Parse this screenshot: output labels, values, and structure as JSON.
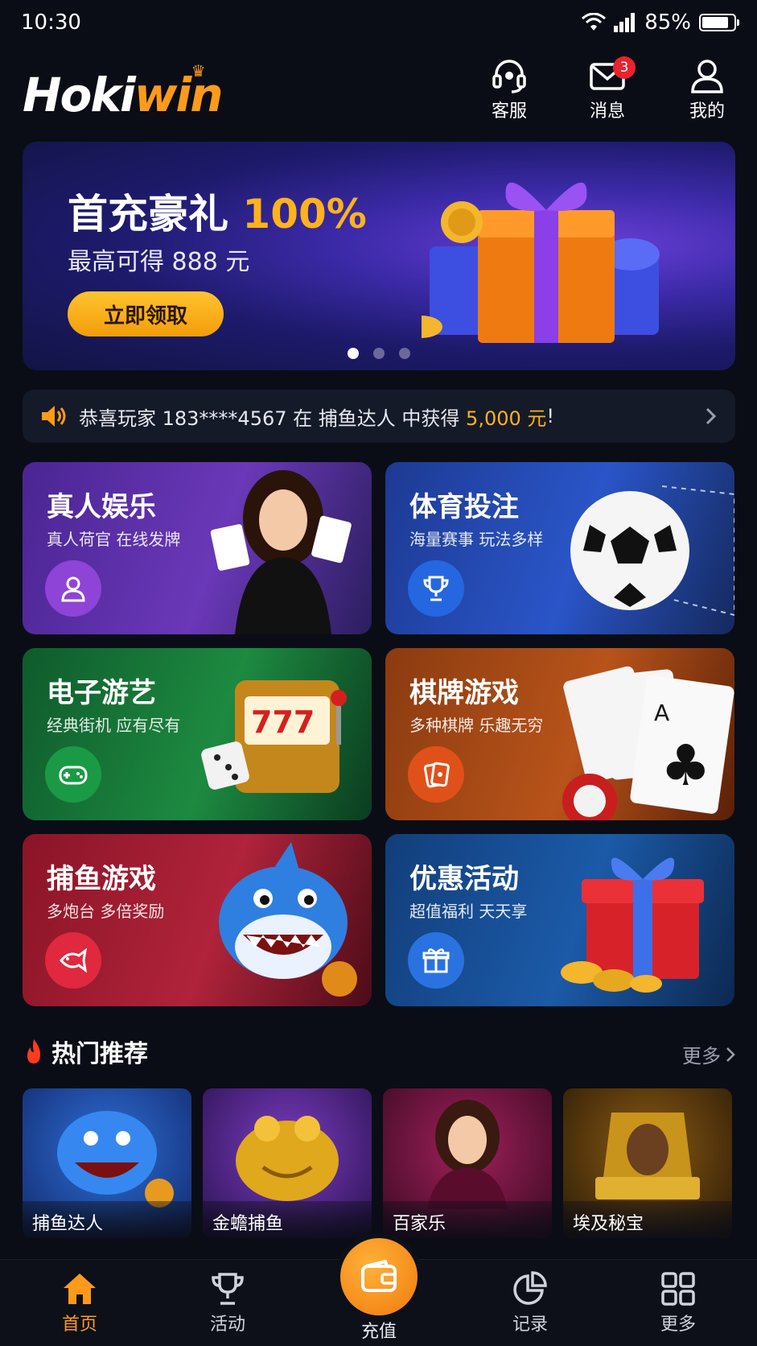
{
  "status": {
    "time": "10:30",
    "battery": "85%",
    "battery_level": 0.85
  },
  "header": {
    "logo_a": "Hoki",
    "logo_b": "win",
    "service_label": "客服",
    "messages_label": "消息",
    "messages_badge": "3",
    "profile_label": "我的"
  },
  "banner": {
    "title": "首充豪礼",
    "title_highlight": "100%",
    "subtitle": "最高可得 888 元",
    "cta": "立即领取",
    "active_slide": 1,
    "slides": 3
  },
  "notice": {
    "prefix": "恭喜玩家 183****4567 在 捕鱼达人 中获得",
    "amount": "5,000 元",
    "suffix": "!"
  },
  "categories": [
    {
      "title": "真人娱乐",
      "sub": "真人荷官 在线发牌",
      "icon": "user-icon"
    },
    {
      "title": "体育投注",
      "sub": "海量赛事 玩法多样",
      "icon": "trophy-icon"
    },
    {
      "title": "电子游艺",
      "sub": "经典街机 应有尽有",
      "icon": "gamepad-icon"
    },
    {
      "title": "棋牌游戏",
      "sub": "多种棋牌 乐趣无穷",
      "icon": "cards-icon"
    },
    {
      "title": "捕鱼游戏",
      "sub": "多炮台 多倍奖励",
      "icon": "fish-icon"
    },
    {
      "title": "优惠活动",
      "sub": "超值福利 天天享",
      "icon": "gift-icon"
    }
  ],
  "hot": {
    "title": "热门推荐",
    "more": "更多",
    "games": [
      "捕鱼达人",
      "金蟾捕鱼",
      "百家乐",
      "埃及秘宝"
    ]
  },
  "tabbar": {
    "home": "首页",
    "activity": "活动",
    "deposit": "充值",
    "records": "记录",
    "more": "更多"
  },
  "colors": {
    "accent": "#ff9a1a",
    "gold": "#ffb21d",
    "background": "#0a0d16"
  }
}
